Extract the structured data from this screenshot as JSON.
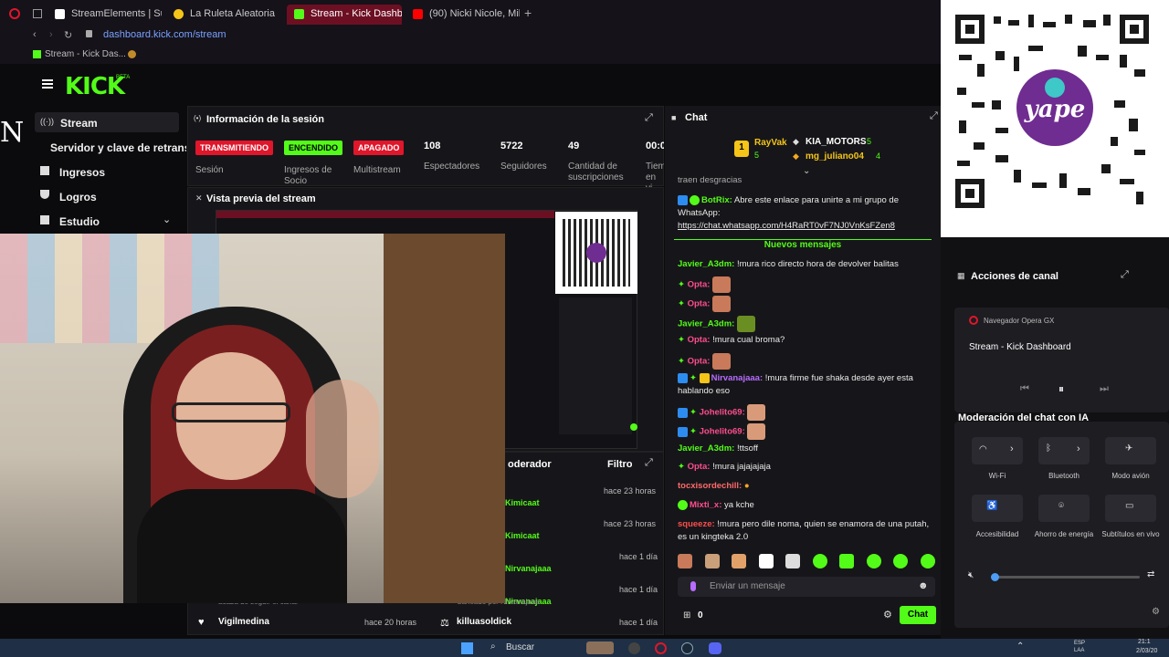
{
  "browser": {
    "tabs": [
      {
        "label": "StreamElements | Subathon",
        "active": false
      },
      {
        "label": "La Ruleta Aleatoria",
        "active": false
      },
      {
        "label": "Stream - Kick Dashboard",
        "active": true
      },
      {
        "label": "(90) Nicki Nicole, Milo J - Bu",
        "active": false
      }
    ],
    "url": "dashboard.kick.com/stream",
    "bookmark": "Stream - Kick Das..."
  },
  "kick": {
    "logo": "KICK",
    "beta": "BETA"
  },
  "sidebar": {
    "items": [
      {
        "label": "Stream",
        "icon": "broadcast-icon"
      },
      {
        "label": "Servidor y clave de retransmisión",
        "icon": ""
      },
      {
        "label": "Ingresos",
        "icon": "bank-icon"
      },
      {
        "label": "Logros",
        "icon": "trophy-icon"
      },
      {
        "label": "Estudio",
        "icon": "film-icon"
      }
    ]
  },
  "session": {
    "title": "Información de la sesión",
    "badges": [
      {
        "label": "TRANSMITIENDO",
        "color": "#e0162b",
        "caption": "Sesión"
      },
      {
        "label": "ENCENDIDO",
        "color": "#53fc18",
        "caption": "Ingresos de Socio"
      },
      {
        "label": "APAGADO",
        "color": "#e0162b",
        "caption": "Multistream"
      }
    ],
    "stats": [
      {
        "value": "108",
        "caption": "Espectadores"
      },
      {
        "value": "5722",
        "caption": "Seguidores"
      },
      {
        "value": "49",
        "caption": "Cantidad de suscripciones"
      },
      {
        "value": "00:0",
        "caption": "Tiem en vi"
      }
    ]
  },
  "preview": {
    "title": "Vista previa del stream"
  },
  "activity": {
    "partial_title": "oderador",
    "filter_label": "Filtro",
    "rows": [
      {
        "user": "Kimicaat",
        "time": "hace 23 horas"
      },
      {
        "user": "Kimicaat",
        "time": "hace 23 horas"
      },
      {
        "user": "Nirvanajaaa",
        "time": "hace 1 día"
      },
      {
        "user": "Nirvanajaaa",
        "time": "hace 1 día"
      }
    ],
    "bottom": [
      {
        "user": "Vigilmedina",
        "time": "hace 20 horas",
        "prefix": "acaba de seguir el canal"
      },
      {
        "user": "killuasoldick",
        "time": "hace 1 día",
        "prefix": "baneado por Nirvanajaaa"
      }
    ]
  },
  "chat": {
    "title": "Chat",
    "top_gifters": [
      {
        "rank": "1",
        "name": "RayVak",
        "count": "5"
      },
      {
        "rank": "",
        "name": "KIA_MOTORS",
        "count": "5"
      },
      {
        "rank": "",
        "name": "mg_juliano04",
        "count": "4"
      }
    ],
    "partial_top": "traen desgracias",
    "botrix_name": "BotRix:",
    "botrix_text": "Abre este enlace para unirte a mi grupo de WhatsApp:",
    "botrix_link": "https://chat.whatsapp.com/H4RaRT0vF7NJ0VnKsFZen8",
    "new_messages": "Nuevos mensajes",
    "messages": [
      {
        "user": "Javier_A3dm:",
        "text": "!mura rico directo hora de devolver balitas",
        "color": "#53fc18"
      },
      {
        "user": "Opta:",
        "text": "",
        "color": "#ff4d8d"
      },
      {
        "user": "Opta:",
        "text": "",
        "color": "#ff4d8d"
      },
      {
        "user": "Javier_A3dm:",
        "text": "",
        "color": "#53fc18"
      },
      {
        "user": "Opta:",
        "text": "!mura cual broma?",
        "color": "#ff4d8d"
      },
      {
        "user": "Opta:",
        "text": "",
        "color": "#ff4d8d"
      },
      {
        "user": "Nirvanajaaa:",
        "text": "!mura firme fue shaka desde ayer esta hablando eso",
        "color": "#b86bff"
      },
      {
        "user": "Johelito69:",
        "text": "",
        "color": "#ff4d8d"
      },
      {
        "user": "Johelito69:",
        "text": "",
        "color": "#ff4d8d"
      },
      {
        "user": "Javier_A3dm:",
        "text": "!ttsoff",
        "color": "#53fc18"
      },
      {
        "user": "Opta:",
        "text": "!mura jajajajaja",
        "color": "#ff4d8d"
      },
      {
        "user": "tocxisordechill:",
        "text": "",
        "color": "#ff6a6a"
      },
      {
        "user": "Mixti_x:",
        "text": "ya kche",
        "color": "#ff4d8d"
      },
      {
        "user": "squeeze:",
        "text": "!mura pero dile noma, quien se enamora de una putah, es un kingteka 2.0",
        "color": "#ff4d4d"
      }
    ],
    "input_placeholder": "Enviar un mensaje",
    "count": "0",
    "send_label": "Chat"
  },
  "right": {
    "yape_text": "yape",
    "acciones": "Acciones de canal",
    "moderacion": "Moderación del chat con IA",
    "media": {
      "app": "Navegador Opera GX",
      "title": "Stream - Kick Dashboard"
    },
    "quick": [
      {
        "label": "Wi-Fi",
        "icon": "wifi-icon"
      },
      {
        "label": "Bluetooth",
        "icon": "bluetooth-icon"
      },
      {
        "label": "Modo avión",
        "icon": "airplane-icon"
      },
      {
        "label": "Accesibilidad",
        "icon": "accessibility-icon"
      },
      {
        "label": "Ahorro de energía",
        "icon": "battery-saver-icon"
      },
      {
        "label": "Subtítulos en vivo",
        "icon": "captions-icon"
      }
    ],
    "volume": 0.0
  },
  "taskbar": {
    "search_label": "Buscar",
    "time": "21:1",
    "date": "2/03/20",
    "lang": "ESP LAA"
  },
  "colors": {
    "kick_green": "#53fc18",
    "live_red": "#e0162b",
    "yape_purple": "#6f2c91"
  }
}
